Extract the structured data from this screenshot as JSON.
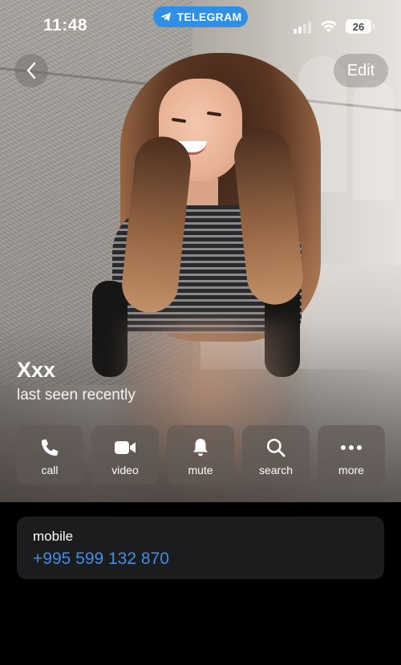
{
  "status_bar": {
    "time": "11:48",
    "app_pill": "TELEGRAM",
    "battery_level": "26",
    "signal_bars_active": 2,
    "signal_bars_total": 4
  },
  "nav": {
    "edit_label": "Edit"
  },
  "profile": {
    "name": "Xxx",
    "status": "last seen recently"
  },
  "actions": [
    {
      "label": "call",
      "icon": "phone-icon"
    },
    {
      "label": "video",
      "icon": "video-camera-icon"
    },
    {
      "label": "mute",
      "icon": "bell-icon"
    },
    {
      "label": "search",
      "icon": "magnifier-icon"
    },
    {
      "label": "more",
      "icon": "more-dots-icon"
    }
  ],
  "info": {
    "label": "mobile",
    "value": "+995 599 132 870"
  },
  "colors": {
    "accent": "#3e8fe8",
    "telegram_pill": "#2f8fe6",
    "card_bg": "#1c1c1e",
    "page_bg": "#000000"
  }
}
